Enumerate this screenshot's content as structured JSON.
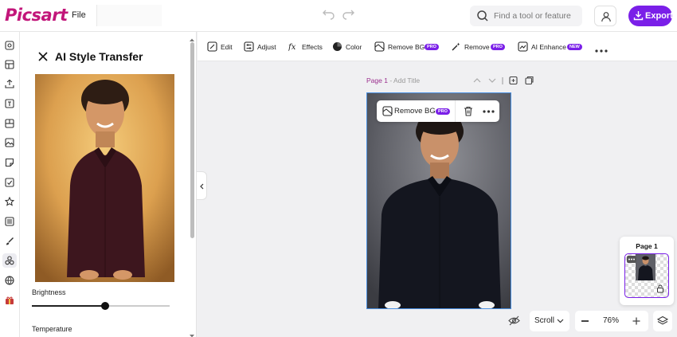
{
  "app": {
    "logo_text": "Picsart",
    "file_menu": "File"
  },
  "search": {
    "placeholder": "Find a tool or feature"
  },
  "export_label": "Export",
  "left_rail": {
    "icons": [
      "templates-icon",
      "layouts-icon",
      "upload-icon",
      "text-icon",
      "grid-icon",
      "photos-icon",
      "stickers-icon",
      "elements-icon",
      "backgrounds-icon",
      "draw-icon",
      "tools-icon",
      "brand-icon",
      "gift-icon"
    ]
  },
  "panel": {
    "title": "AI Style Transfer",
    "brightness_label": "Brightness",
    "brightness_value": 0.53,
    "temperature_label": "Temperature"
  },
  "toolbar": {
    "items": [
      {
        "label": "Edit"
      },
      {
        "label": "Adjust"
      },
      {
        "label": "Effects"
      },
      {
        "label": "Color"
      },
      {
        "label": "Remove BG",
        "badge": "PRO"
      },
      {
        "label": "Remove",
        "badge": "PRO"
      },
      {
        "label": "AI Enhance",
        "badge": "NEW"
      }
    ]
  },
  "page_header": {
    "page": "Page 1",
    "separator": " - ",
    "title_placeholder": "Add Title"
  },
  "floating_bar": {
    "remove_bg": "Remove BG",
    "badge": "PRO"
  },
  "pages_panel": {
    "title": "Page 1"
  },
  "bottom": {
    "scroll_label": "Scroll",
    "zoom": "76%"
  },
  "colors": {
    "accent": "#7a1fe8",
    "brand": "#c2167a",
    "badge_pro": "#7a1fe8"
  }
}
